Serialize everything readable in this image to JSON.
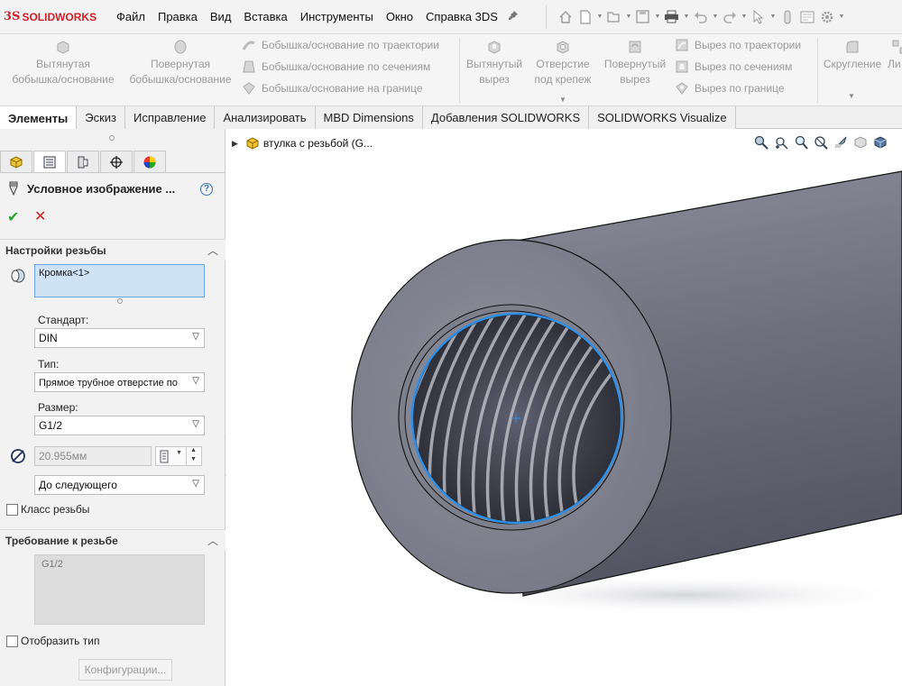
{
  "app": {
    "logo_mark": "3S",
    "logo_text": "SOLIDWORKS"
  },
  "menu": [
    "Файл",
    "Правка",
    "Вид",
    "Вставка",
    "Инструменты",
    "Окно",
    "Справка 3DS"
  ],
  "quick_access_icons": [
    "home-icon",
    "new-file-icon",
    "open-icon",
    "save-icon",
    "print-icon",
    "undo-icon",
    "redo-icon",
    "select-cursor-icon",
    "rebuild-icon",
    "file-properties-icon",
    "options-gear-icon"
  ],
  "commands": {
    "extrude_boss": "Вытянутая\nбобышка/основание",
    "revolve_boss": "Повернутая\nбобышка/основание",
    "sweep_boss": "Бобышка/основание по траектории",
    "loft_boss": "Бобышка/основание по сечениям",
    "boundary_boss": "Бобышка/основание на границе",
    "extrude_cut": "Вытянутый\nвырез",
    "hole_wizard": "Отверстие\nпод крепеж",
    "revolve_cut": "Повернутый\nвырез",
    "sweep_cut": "Вырез по траектории",
    "loft_cut": "Вырез по сечениям",
    "boundary_cut": "Вырез по границе",
    "fillet": "Скругление",
    "linear_pattern": "Ли"
  },
  "tabs": [
    {
      "label": "Элементы",
      "active": true
    },
    {
      "label": "Эскиз",
      "active": false
    },
    {
      "label": "Исправление",
      "active": false
    },
    {
      "label": "Анализировать",
      "active": false
    },
    {
      "label": "MBD Dimensions",
      "active": false
    },
    {
      "label": "Добавления SOLIDWORKS",
      "active": false
    },
    {
      "label": "SOLIDWORKS Visualize",
      "active": false
    }
  ],
  "property_manager": {
    "title": "Условное изображение ...",
    "help": "?",
    "ok_symbol": "✔",
    "cancel_symbol": "✕",
    "thread_settings": {
      "header": "Настройки резьбы",
      "edge_selection": "Кромка<1>",
      "standard_label": "Стандарт:",
      "standard_value": "DIN",
      "type_label": "Тип:",
      "type_value": "Прямое трубное отверстие по",
      "size_label": "Размер:",
      "size_value": "G1/2",
      "diameter_value": "20.955мм",
      "end_condition": "До следующего",
      "thread_class_label": "Класс резьбы",
      "thread_class_checked": false
    },
    "thread_callout": {
      "header": "Требование к резьбе",
      "value": "G1/2",
      "show_type_label": "Отобразить тип",
      "show_type_checked": false,
      "configurations_button": "Конфигурации..."
    }
  },
  "feature_tree": {
    "root_label": "втулка с резьбой (G..."
  },
  "hud_icons": [
    "zoom-to-fit-icon",
    "zoom-to-area-icon",
    "previous-view-icon",
    "section-view-icon",
    "view-orientation-icon",
    "display-style-icon",
    "hide-show-icon"
  ],
  "colors": {
    "accent": "#d0202a",
    "selection_blue": "#2e8fe8",
    "selection_fill": "#cfe3f7",
    "ok_green": "#2aa52a",
    "cancel_red": "#d42020",
    "model_gray": "#7b7d89"
  }
}
